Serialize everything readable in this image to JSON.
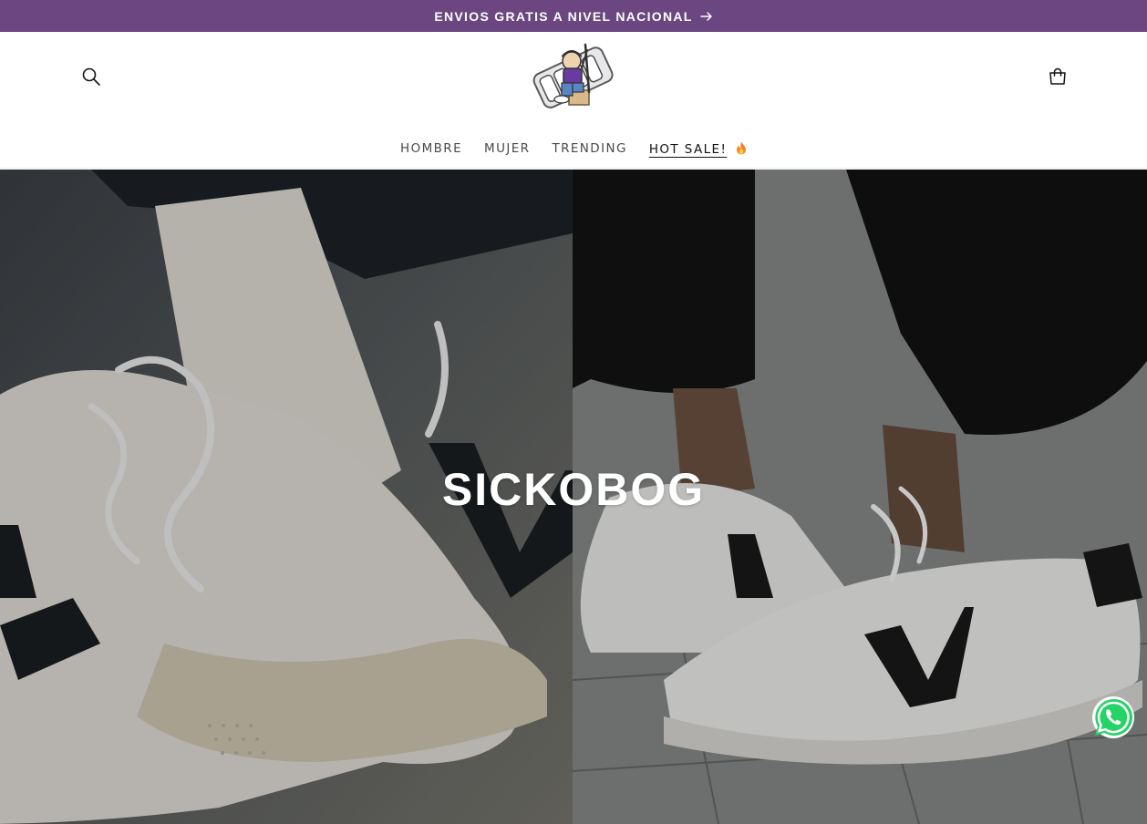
{
  "announcement": {
    "text": "ENVIOS GRATIS A NIVEL NACIONAL",
    "arrow_icon": "arrow-right-icon",
    "background": "#6b4680"
  },
  "header": {
    "search_icon": "search-icon",
    "cart_icon": "cart-icon",
    "logo_icon": "brand-mascot-logo"
  },
  "nav": {
    "items": [
      {
        "label": "HOMBRE"
      },
      {
        "label": "MUJER"
      },
      {
        "label": "TRENDING"
      },
      {
        "label": "HOT SALE!",
        "icon": "fire-emoji-icon"
      }
    ],
    "active_index": 3
  },
  "hero": {
    "title": "SICKOBOG"
  },
  "floating": {
    "whatsapp_icon": "whatsapp-icon",
    "whatsapp_color": "#25d366"
  }
}
